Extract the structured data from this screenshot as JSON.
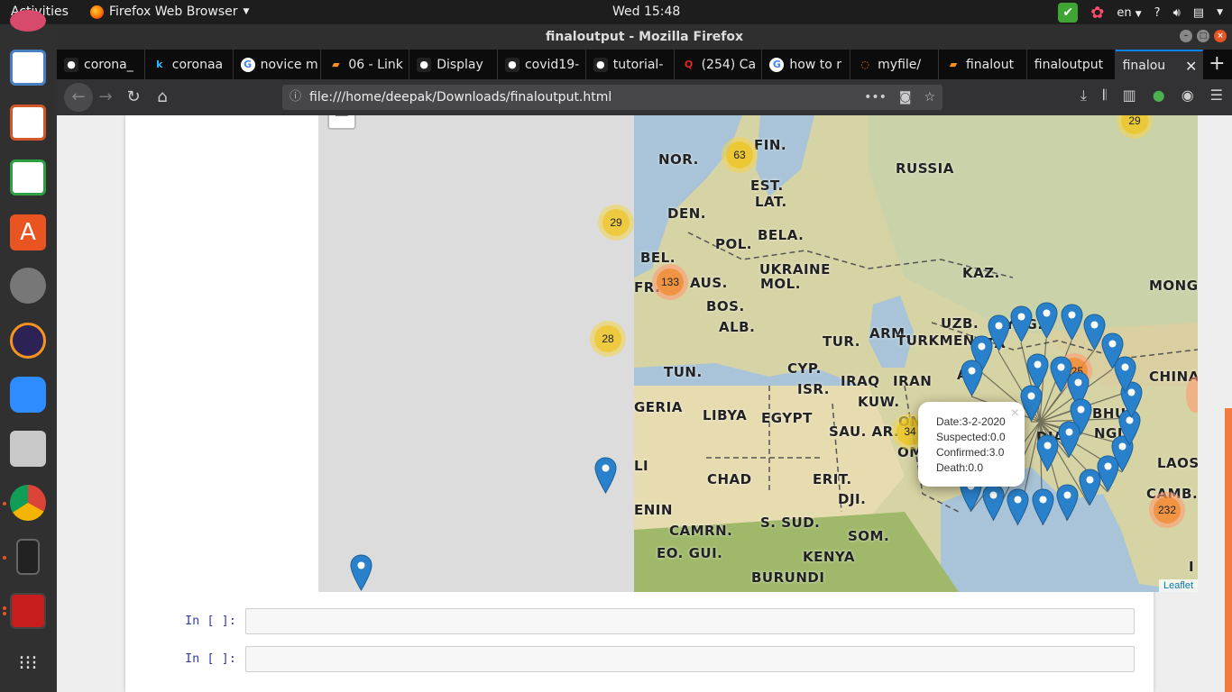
{
  "topbar": {
    "activities": "Activities",
    "app_name": "Firefox Web Browser",
    "clock": "Wed 15:48",
    "lang": "en",
    "help": "?"
  },
  "window": {
    "title": "finaloutput - Mozilla Firefox"
  },
  "tabs": [
    {
      "label": "corona_",
      "icon": "github-icon"
    },
    {
      "label": "coronaa",
      "icon": "kaggle-icon"
    },
    {
      "label": "novice m",
      "icon": "google-icon"
    },
    {
      "label": "06 - Link",
      "icon": "book-icon"
    },
    {
      "label": "Display",
      "icon": "github-icon"
    },
    {
      "label": "covid19-",
      "icon": "github-icon"
    },
    {
      "label": "tutorial-",
      "icon": "github-icon"
    },
    {
      "label": "(254) Ca",
      "icon": "quora-icon"
    },
    {
      "label": "how to r",
      "icon": "google-icon"
    },
    {
      "label": "myfile/",
      "icon": "jupyter-icon"
    },
    {
      "label": "finalout",
      "icon": "book-icon"
    },
    {
      "label": "finaloutput",
      "icon": "none"
    },
    {
      "label": "finalou",
      "icon": "none",
      "active": true
    }
  ],
  "url": "file:///home/deepak/Downloads/finaloutput.html",
  "map": {
    "attribution": "Leaflet",
    "zoom_out": "−",
    "countries": [
      "FIN.",
      "NOR.",
      "RUSSIA",
      "EST.",
      "LAT.",
      "DEN.",
      "BELA.",
      "POL.",
      "BEL.",
      "UKRAINE",
      "FR.",
      "AUS.",
      "MOL.",
      "KAZ.",
      "MONG.",
      "BOS.",
      "ALB.",
      "KYRG.",
      "UZB.",
      "TUR.",
      "ARM.",
      "TURKMEN.",
      "TUN.",
      "CYP.",
      "IRAQ",
      "IRAN",
      "ISR.",
      "KUW.",
      "CHINA",
      "GERIA",
      "LIBYA",
      "EGYPT",
      "SAU. AR.",
      "BHU.",
      "NGL.",
      "DIA",
      "LAOS",
      "LI",
      "CHAD",
      "ERIT.",
      "DJI.",
      "CAMB.",
      "ENIN",
      "S. SUD.",
      "CAMRN.",
      "SOM.",
      "EO. GUI.",
      "KENYA",
      "BURUNDI",
      "ON",
      "OM",
      "AF",
      "TA",
      "I"
    ],
    "clusters": [
      {
        "count": "63",
        "size": "med"
      },
      {
        "count": "29",
        "size": "med"
      },
      {
        "count": "29",
        "size": "med"
      },
      {
        "count": "133",
        "size": "large"
      },
      {
        "count": "28",
        "size": "med"
      },
      {
        "count": "125",
        "size": "large"
      },
      {
        "count": "34",
        "size": "med"
      },
      {
        "count": "232",
        "size": "large"
      }
    ],
    "popup": {
      "line1": "Date:3-2-2020",
      "line2": "Suspected:0.0",
      "line3": "Confirmed:3.0",
      "line4": "Death:0.0",
      "close": "×"
    }
  },
  "cells": [
    {
      "prompt": "In [ ]:"
    },
    {
      "prompt": "In [ ]:"
    }
  ],
  "colors": {
    "accent": "#0a84ff",
    "marker": "#2a81cb",
    "ubuntu_orange": "#e95420",
    "prompt": "#303f9f"
  }
}
